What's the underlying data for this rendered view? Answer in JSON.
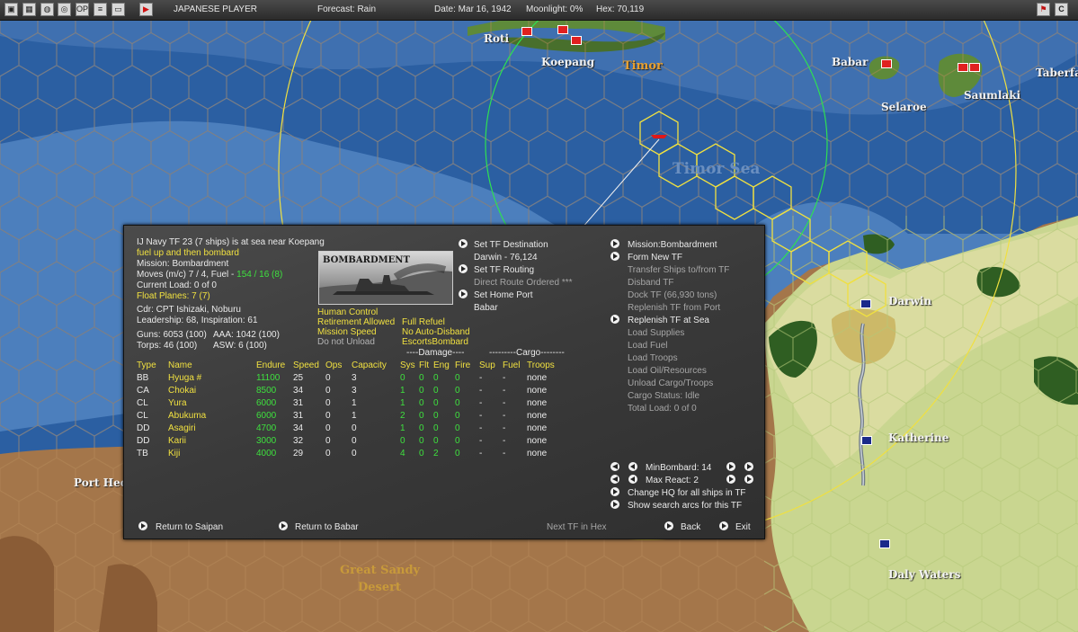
{
  "topbar": {
    "player": "JAPANESE PLAYER",
    "forecast": "Forecast: Rain",
    "date": "Date: Mar 16, 1942",
    "moonlight": "Moonlight: 0%",
    "hex": "Hex: 70,119",
    "left_icons": [
      "game-icon",
      "map-icon",
      "globe-icon",
      "target-icon",
      "op-icon",
      "list-icon",
      "window-icon",
      "play-icon"
    ],
    "op_label": "OP",
    "right_icons": [
      "flag-icon",
      "c-icon",
      "close-icon"
    ],
    "c_label": "C"
  },
  "map": {
    "labels": {
      "roti": "Roti",
      "koepang": "Koepang",
      "timor": "Timor",
      "babar": "Babar",
      "selaroe": "Selaroe",
      "saumlaki": "Saumlaki",
      "taberfane": "Taberfa",
      "timor_sea": "Timor Sea",
      "darwin": "Darwin",
      "katherine": "Katherine",
      "port_hedland": "Port Hed",
      "great_sandy": "Great Sandy",
      "desert": "Desert",
      "daly_waters": "Daly Waters"
    }
  },
  "panel": {
    "header": {
      "tf_title": "IJ Navy TF 23 (7 ships) is at sea near Koepang",
      "orders": "fuel up and then bombard",
      "mission": "Mission: Bombardment",
      "moves_label": "Moves (m/c) 7 / 4, Fuel - ",
      "fuel_value": "154 / 16 (8)",
      "current_load": "Current Load: 0 of 0",
      "float_planes": "Float Planes: 7 (7)",
      "cdr": "Cdr: CPT Ishizaki, Noburu",
      "leadership": "Leadership: 68, Inspiration: 61",
      "guns": "Guns: 6053 (100)",
      "aaa": "AAA: 1042 (100)",
      "torps": "Torps: 46 (100)",
      "asw": "ASW: 6 (100)"
    },
    "photo_title": "BOMBARDMENT",
    "options": {
      "human_control": "Human Control",
      "full_refuel": "Full Refuel",
      "retirement": "Retirement Allowed",
      "no_auto_disband": "No Auto-Disband",
      "mission_speed": "Mission Speed",
      "escorts_bombard": "EscortsBombard",
      "do_not_unload": "Do not Unload"
    },
    "routing": {
      "set_destination": "Set TF Destination",
      "destination": "Darwin - 76,124",
      "set_routing": "Set TF Routing",
      "direct_route": "Direct Route Ordered ***",
      "set_home_port": "Set Home Port",
      "home_port": "Babar"
    },
    "commands": [
      {
        "label": "Mission:Bombardment",
        "arrow": true,
        "dim": false
      },
      {
        "label": "Form New TF",
        "arrow": true,
        "dim": false
      },
      {
        "label": "Transfer Ships to/from TF",
        "arrow": false,
        "dim": true
      },
      {
        "label": "Disband TF",
        "arrow": false,
        "dim": true
      },
      {
        "label": "Dock TF (66,930 tons)",
        "arrow": false,
        "dim": true
      },
      {
        "label": "Replenish TF from Port",
        "arrow": false,
        "dim": true
      },
      {
        "label": "Replenish TF at Sea",
        "arrow": true,
        "dim": false
      },
      {
        "label": "Load Supplies",
        "arrow": false,
        "dim": true
      },
      {
        "label": "Load Fuel",
        "arrow": false,
        "dim": true
      },
      {
        "label": "Load Troops",
        "arrow": false,
        "dim": true
      },
      {
        "label": "Load Oil/Resources",
        "arrow": false,
        "dim": true
      },
      {
        "label": "Unload Cargo/Troops",
        "arrow": false,
        "dim": true
      },
      {
        "label": "Cargo Status: Idle",
        "arrow": false,
        "dim": true
      },
      {
        "label": "Total Load: 0 of 0",
        "arrow": false,
        "dim": true
      }
    ],
    "table": {
      "damage_header": "----Damage----",
      "cargo_header": "---------Cargo--------",
      "columns": [
        "Type",
        "Name",
        "Endure",
        "Speed",
        "Ops",
        "Capacity",
        "Sys",
        "Flt",
        "Eng",
        "Fire",
        "Sup",
        "Fuel",
        "Troops"
      ],
      "rows": [
        [
          "BB",
          "Hyuga #",
          "11100",
          "25",
          "0",
          "3",
          "0",
          "0",
          "0",
          "0",
          "-",
          "-",
          "none"
        ],
        [
          "CA",
          "Chokai",
          "8500",
          "34",
          "0",
          "3",
          "1",
          "0",
          "0",
          "0",
          "-",
          "-",
          "none"
        ],
        [
          "CL",
          "Yura",
          "6000",
          "31",
          "0",
          "1",
          "1",
          "0",
          "0",
          "0",
          "-",
          "-",
          "none"
        ],
        [
          "CL",
          "Abukuma",
          "6000",
          "31",
          "0",
          "1",
          "2",
          "0",
          "0",
          "0",
          "-",
          "-",
          "none"
        ],
        [
          "DD",
          "Asagiri",
          "4700",
          "34",
          "0",
          "0",
          "1",
          "0",
          "0",
          "0",
          "-",
          "-",
          "none"
        ],
        [
          "DD",
          "Karii",
          "3000",
          "32",
          "0",
          "0",
          "0",
          "0",
          "0",
          "0",
          "-",
          "-",
          "none"
        ],
        [
          "TB",
          "Kiji",
          "4000",
          "29",
          "0",
          "0",
          "4",
          "0",
          "2",
          "0",
          "-",
          "-",
          "none"
        ]
      ]
    },
    "min_bombard": "MinBombard: 14",
    "max_react": "Max React: 2",
    "change_hq": "Change HQ for all ships in TF",
    "show_search": "Show search arcs for this TF",
    "footer": {
      "return_saipan": "Return to Saipan",
      "return_babar": "Return to Babar",
      "next_tf": "Next TF in Hex",
      "back": "Back",
      "exit": "Exit"
    }
  }
}
